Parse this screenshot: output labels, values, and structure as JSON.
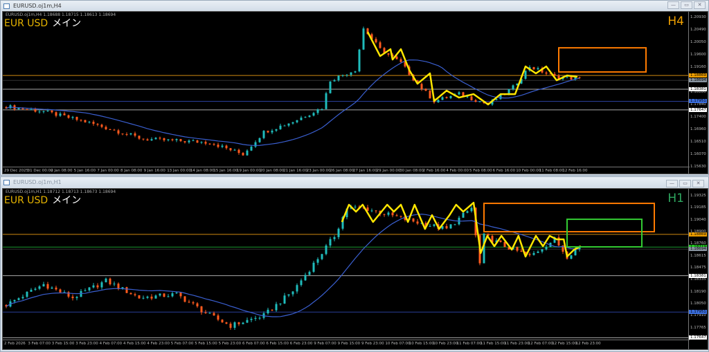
{
  "windows": [
    {
      "title": "EURUSD.oj1m,H4",
      "info": "EURUSD.oj1m,H4  1.18688 1.18715 1.18613 1.18694",
      "symbol": "EUR USD",
      "symbol_suffix": "メイン",
      "timeframe": "H4",
      "timeframe_color": "#f0a000",
      "buttons": [
        "—",
        "▭",
        "✕"
      ]
    },
    {
      "title": "EURUSD.oj1m,H1",
      "info": "EURUSD.oj1m,H1  1.18712 1.18713 1.18673 1.18694",
      "symbol": "EUR USD",
      "symbol_suffix": "メイン",
      "timeframe": "H1",
      "timeframe_color": "#2ea860",
      "buttons": [
        "—",
        "▭",
        "✕"
      ]
    }
  ],
  "colors": {
    "bull": "#1fbcbc",
    "bear": "#ff5a1e",
    "zigzag": "#ffe600",
    "ma": "#3a5fd0"
  },
  "chart_data": [
    {
      "type": "candlestick",
      "title": "EURUSD H4",
      "ylim": [
        1.1563,
        1.2113
      ],
      "y_ticks": [
        "1.20930",
        "1.20490",
        "1.20050",
        "1.19600",
        "1.19160",
        "1.18280",
        "1.17840",
        "1.17400",
        "1.16960",
        "1.16510",
        "1.16070",
        "1.15630"
      ],
      "x_labels": [
        "29 Dec 2025",
        "31 Dec 00:00",
        "2 Jan 08:00",
        "5 Jan 16:00",
        "7 Jan 00:00",
        "8 Jan 08:00",
        "9 Jan 16:00",
        "13 Jan 00:00",
        "14 Jan 08:00",
        "15 Jan 16:00",
        "19 Jan 00:00",
        "20 Jan 08:00",
        "21 Jan 16:00",
        "23 Jan 00:00",
        "26 Jan 08:00",
        "27 Jan 16:00",
        "29 Jan 00:00",
        "30 Jan 08:00",
        "2 Feb 16:00",
        "4 Feb 00:00",
        "5 Feb 08:00",
        "6 Feb 16:00",
        "10 Feb 00:00",
        "11 Feb 08:00",
        "12 Feb 16:00"
      ],
      "candle_count": 139,
      "noise": 0.0014,
      "price_path": [
        [
          0,
          1.1777
        ],
        [
          9,
          1.1759
        ],
        [
          19,
          1.1723
        ],
        [
          33,
          1.1661
        ],
        [
          49,
          1.1649
        ],
        [
          57,
          1.1607
        ],
        [
          62,
          1.1686
        ],
        [
          69,
          1.1723
        ],
        [
          76,
          1.1772
        ],
        [
          78,
          1.187
        ],
        [
          84,
          1.1907
        ],
        [
          86,
          1.2054
        ],
        [
          90,
          1.198
        ],
        [
          95,
          1.1931
        ],
        [
          99,
          1.1857
        ],
        [
          103,
          1.1796
        ],
        [
          109,
          1.1821
        ],
        [
          116,
          1.1784
        ],
        [
          122,
          1.1845
        ],
        [
          126,
          1.1919
        ],
        [
          132,
          1.1882
        ],
        [
          138,
          1.1875
        ]
      ],
      "zigzag": [
        [
          87,
          1.20415
        ],
        [
          90,
          1.19556
        ],
        [
          92.5,
          1.19801
        ],
        [
          93,
          1.19433
        ],
        [
          95,
          1.19801
        ],
        [
          97,
          1.19065
        ],
        [
          99,
          1.18574
        ],
        [
          102,
          1.18942
        ],
        [
          103,
          1.17961
        ],
        [
          106,
          1.18329
        ],
        [
          109,
          1.18083
        ],
        [
          112.5,
          1.18206
        ],
        [
          116,
          1.17838
        ],
        [
          119,
          1.18206
        ],
        [
          122.5,
          1.18206
        ],
        [
          125,
          1.19188
        ],
        [
          127.5,
          1.18942
        ],
        [
          130,
          1.19188
        ],
        [
          132.5,
          1.18697
        ],
        [
          135,
          1.18869
        ],
        [
          137.5,
          1.1882
        ]
      ],
      "levels": [
        {
          "price": "1.18869",
          "color": "#d08a10",
          "label_bg": "#f0a000"
        },
        {
          "price": "1.18694",
          "color": "#333333",
          "label_bg": "#8894a0"
        },
        {
          "price": "1.18381",
          "color": "#aaaaaa",
          "label_bg": "#ffffff"
        },
        {
          "price": "1.17951",
          "color": "#2a3e9a",
          "label_bg": "#3b6fe0"
        },
        {
          "price": "1.17647",
          "color": "#aaaaaa",
          "label_bg": "#ffffff"
        }
      ],
      "boxes": [
        {
          "from": 133,
          "to": 154,
          "high": 1.1985,
          "low": 1.18992,
          "color": "#ff7b00"
        }
      ]
    },
    {
      "type": "candlestick",
      "title": "EURUSD H1",
      "ylim": [
        1.17626,
        1.19407
      ],
      "y_ticks": [
        "1.19325",
        "1.19185",
        "1.19040",
        "1.18900",
        "1.18760",
        "1.18615",
        "1.18475",
        "1.18335",
        "1.18190",
        "1.18050",
        "1.17910",
        "1.17765"
      ],
      "x_labels": [
        "2 Feb 2026",
        "3 Feb 07:00",
        "3 Feb 15:00",
        "3 Feb 23:00",
        "4 Feb 07:00",
        "4 Feb 15:00",
        "4 Feb 23:00",
        "5 Feb 07:00",
        "5 Feb 15:00",
        "5 Feb 23:00",
        "6 Feb 07:00",
        "6 Feb 15:00",
        "6 Feb 23:00",
        "9 Feb 07:00",
        "9 Feb 15:00",
        "9 Feb 23:00",
        "10 Feb 07:00",
        "10 Feb 15:00",
        "10 Feb 23:00",
        "11 Feb 07:00",
        "11 Feb 15:00",
        "11 Feb 23:00",
        "12 Feb 07:00",
        "12 Feb 15:00",
        "12 Feb 23:00"
      ],
      "candle_count": 139,
      "noise": 0.0006,
      "price_path": [
        [
          0,
          1.18035
        ],
        [
          9,
          1.1828
        ],
        [
          16,
          1.1812
        ],
        [
          24,
          1.1832
        ],
        [
          32,
          1.1812
        ],
        [
          41,
          1.1816
        ],
        [
          49,
          1.1791
        ],
        [
          54,
          1.1779
        ],
        [
          62,
          1.1791
        ],
        [
          69,
          1.182
        ],
        [
          74,
          1.1852
        ],
        [
          79,
          1.1885
        ],
        [
          82,
          1.1918
        ],
        [
          86,
          1.1918
        ],
        [
          92,
          1.191
        ],
        [
          99,
          1.1901
        ],
        [
          106,
          1.1893
        ],
        [
          112,
          1.1918
        ],
        [
          114,
          1.1852
        ],
        [
          115,
          1.1885
        ],
        [
          120,
          1.1873
        ],
        [
          126,
          1.1861
        ],
        [
          132,
          1.1881
        ],
        [
          135,
          1.1861
        ],
        [
          138,
          1.1873
        ]
      ],
      "zigzag": [
        [
          80.8,
          1.19015
        ],
        [
          82.5,
          1.19219
        ],
        [
          84.2,
          1.19137
        ],
        [
          85.8,
          1.19219
        ],
        [
          88.3,
          1.19015
        ],
        [
          91.7,
          1.19219
        ],
        [
          93.3,
          1.19137
        ],
        [
          95,
          1.19219
        ],
        [
          96.7,
          1.19015
        ],
        [
          98.3,
          1.19219
        ],
        [
          100.8,
          1.18933
        ],
        [
          102.5,
          1.19096
        ],
        [
          104.2,
          1.18933
        ],
        [
          106.7,
          1.19096
        ],
        [
          108.3,
          1.19219
        ],
        [
          110,
          1.19137
        ],
        [
          112.5,
          1.19243
        ],
        [
          114.2,
          1.18647
        ],
        [
          115.8,
          1.18851
        ],
        [
          117.5,
          1.18729
        ],
        [
          119.2,
          1.18851
        ],
        [
          121.7,
          1.18688
        ],
        [
          123.3,
          1.18851
        ],
        [
          125,
          1.18606
        ],
        [
          127.5,
          1.18851
        ],
        [
          129.2,
          1.18729
        ],
        [
          130.8,
          1.18851
        ],
        [
          132.5,
          1.1881
        ],
        [
          134.2,
          1.1881
        ],
        [
          135,
          1.18606
        ],
        [
          136.7,
          1.18688
        ],
        [
          138.3,
          1.18729
        ]
      ],
      "levels": [
        {
          "price": "1.18869",
          "color": "#d08a10",
          "label_bg": "#f0a000"
        },
        {
          "price": "1.18719",
          "color": "#1a9a30",
          "label_bg": "#22cc22"
        },
        {
          "price": "1.18694",
          "color": "#333333",
          "label_bg": "#8894a0"
        },
        {
          "price": "1.18381",
          "color": "#aaaaaa",
          "label_bg": "#ffffff"
        },
        {
          "price": "1.17951",
          "color": "#2a3e9a",
          "label_bg": "#3b6fe0"
        },
        {
          "price": "1.17647",
          "color": "#aaaaaa",
          "label_bg": "#ffffff"
        }
      ],
      "boxes": [
        {
          "from": 115,
          "to": 156,
          "high": 1.19235,
          "low": 1.189,
          "color": "#ff7b00"
        },
        {
          "from": 135,
          "to": 153,
          "high": 1.19047,
          "low": 1.18721,
          "color": "#33cc33"
        }
      ]
    }
  ]
}
